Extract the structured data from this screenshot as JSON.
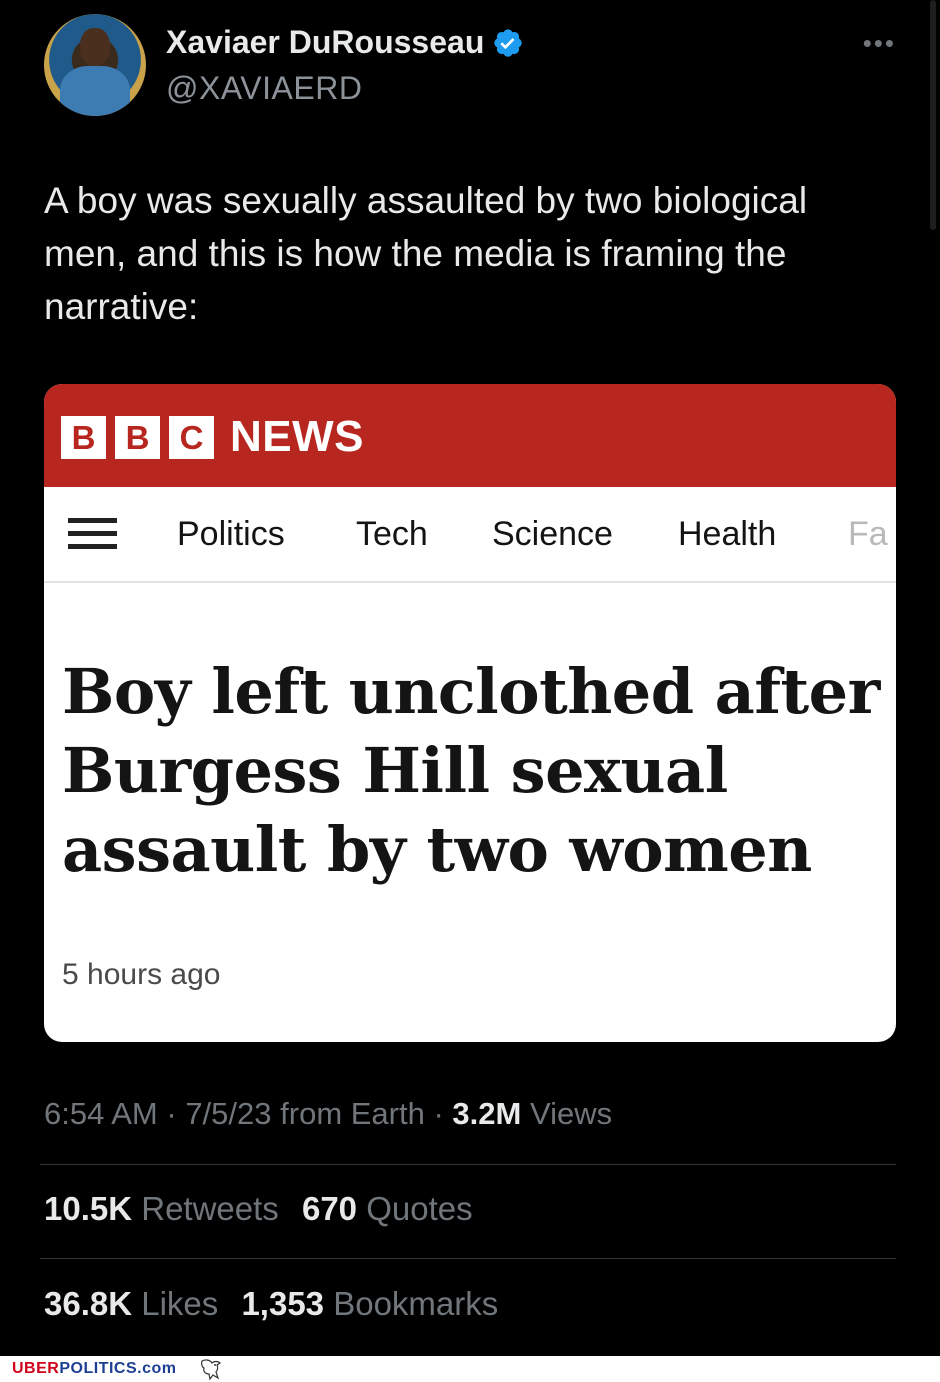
{
  "tweet": {
    "author_name": "Xaviaer DuRousseau",
    "handle": "@XAVIAERD",
    "more_icon": "more-horizontal-icon",
    "text": "A boy was sexually assaulted by two biological men, and this is how the media is framing the narrative:",
    "meta": {
      "time": "6:54 AM",
      "date": "7/5/23",
      "source": "from Earth",
      "views_count": "3.2M",
      "views_label": "Views"
    },
    "stats": {
      "retweets_count": "10.5K",
      "retweets_label": "Retweets",
      "quotes_count": "670",
      "quotes_label": "Quotes",
      "likes_count": "36.8K",
      "likes_label": "Likes",
      "bookmarks_count": "1,353",
      "bookmarks_label": "Bookmarks"
    }
  },
  "bbc_card": {
    "logo_letters": [
      "B",
      "B",
      "C"
    ],
    "logo_word": "NEWS",
    "nav_items": [
      "Politics",
      "Tech",
      "Science",
      "Health",
      "Fa"
    ],
    "headline": "Boy left unclothed after Burgess Hill sexual assault by two women",
    "timestamp": "5 hours ago"
  },
  "footer": {
    "brand_red": "UBER",
    "brand_blue": "POLITICS",
    "brand_suffix": ".com"
  },
  "colors": {
    "background": "#000000",
    "bbc_red": "#b7271f",
    "verified_blue": "#1d9bf0",
    "muted_text": "#71767b"
  }
}
